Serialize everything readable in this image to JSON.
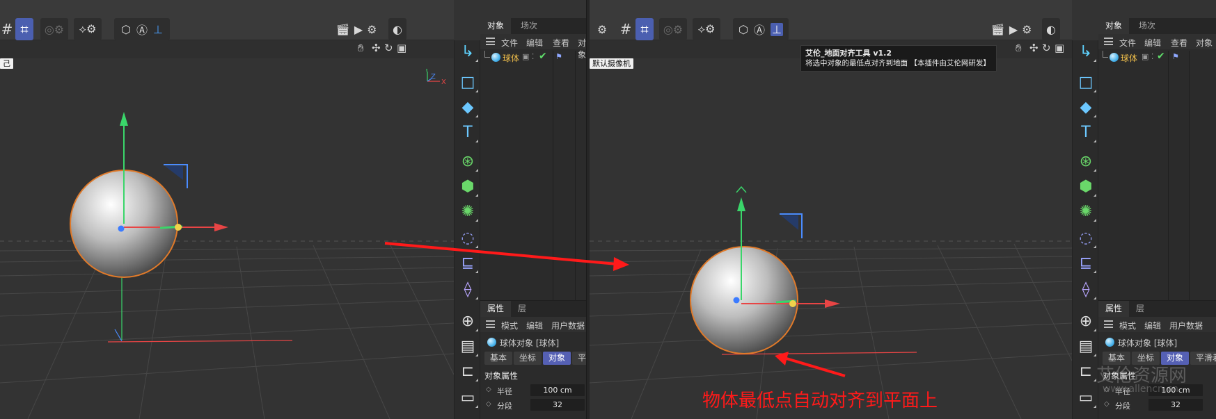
{
  "left": {
    "object_panel": {
      "tabs": [
        "对象",
        "场次"
      ],
      "menu": [
        "文件",
        "编辑",
        "查看",
        "对象"
      ],
      "object": {
        "name": "球体"
      }
    },
    "attributes_panel": {
      "tabs": [
        "属性",
        "层"
      ],
      "menu": [
        "模式",
        "编辑",
        "用户数据"
      ],
      "object_title": "球体对象 [球体]",
      "attr_tabs": [
        "基本",
        "坐标",
        "对象",
        "平滑着色(Phong)"
      ],
      "section": "对象属性",
      "fields": [
        {
          "label": "半径",
          "value": "100 cm"
        },
        {
          "label": "分段",
          "value": "32"
        }
      ]
    }
  },
  "right": {
    "camera_label": "默认摄像机",
    "object_panel": {
      "tabs": [
        "对象",
        "场次"
      ],
      "menu": [
        "文件",
        "编辑",
        "查看",
        "对象"
      ],
      "object": {
        "name": "球体"
      }
    },
    "attributes_panel": {
      "tabs": [
        "属性",
        "层"
      ],
      "menu": [
        "模式",
        "编辑",
        "用户数据"
      ],
      "object_title": "球体对象 [球体]",
      "attr_tabs": [
        "基本",
        "坐标",
        "对象",
        "平滑着色(Phong)"
      ],
      "section": "对象属性",
      "fields": [
        {
          "label": "半径",
          "value": "100 cm"
        },
        {
          "label": "分段",
          "value": "32"
        }
      ]
    },
    "tooltip": {
      "title": "艾伦_地面对齐工具 v1.2",
      "description": "将选中对象的最低点对齐到地面 【本插件由艾伦网研发】"
    }
  },
  "annotation": {
    "caption": "物体最低点自动对齐到平面上",
    "color": "#ff1a1a"
  },
  "watermark": {
    "name": "艾伦资源网",
    "url": "www.allencn.cn"
  },
  "axis_labels": {
    "x": "X",
    "y": "Y",
    "z": "Z"
  },
  "icons": {
    "toolbar": [
      "grid-icon",
      "snap-grid-icon",
      "target-icon",
      "gear-icon",
      "workplane-icon",
      "gear-icon",
      "render-view-icon",
      "axis-lock-icon",
      "ground-align-icon"
    ],
    "render": [
      "clapper-icon",
      "clapper-play-icon",
      "clapper-settings-icon",
      "render-region-icon"
    ],
    "nav": [
      "hand-pan-icon",
      "move-icon",
      "rotate-icon",
      "maximize-icon"
    ],
    "side_tools": [
      "pointer-icon",
      "cube-icon",
      "text-icon",
      "spline-icon",
      "mograph-icon",
      "generator-icon",
      "deformer-icon",
      "field-icon",
      "scene-icon",
      "material-icon",
      "sky-icon",
      "camera-icon"
    ]
  },
  "colors": {
    "x_axis": "#e84545",
    "y_axis": "#3ad66a",
    "z_axis": "#4a8cff",
    "selection_outline": "#e07a2a",
    "accent": "#5560b4"
  }
}
